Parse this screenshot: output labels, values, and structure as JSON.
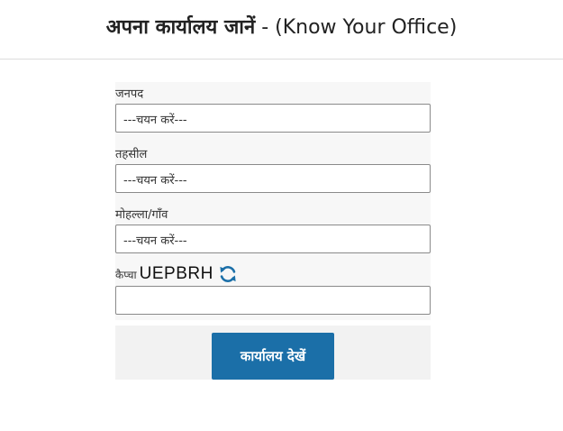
{
  "header": {
    "title_hindi": "अपना कार्यालय जानें",
    "title_english": "- (Know Your Office)"
  },
  "form": {
    "district": {
      "label": "जनपद",
      "value": "---चयन करें---"
    },
    "tehsil": {
      "label": "तहसील",
      "value": "---चयन करें---"
    },
    "locality": {
      "label": "मोहल्ला/गाँव",
      "value": "---चयन करें---"
    },
    "captcha": {
      "label": "कैप्चा",
      "code": "UEPBRH",
      "refresh_icon": "refresh-icon",
      "input_value": ""
    },
    "submit_label": "कार्यालय देखें"
  },
  "colors": {
    "button_bg": "#1b6fa8",
    "refresh_icon": "#1b6fa8",
    "panel_bg": "#f7f7f7"
  }
}
